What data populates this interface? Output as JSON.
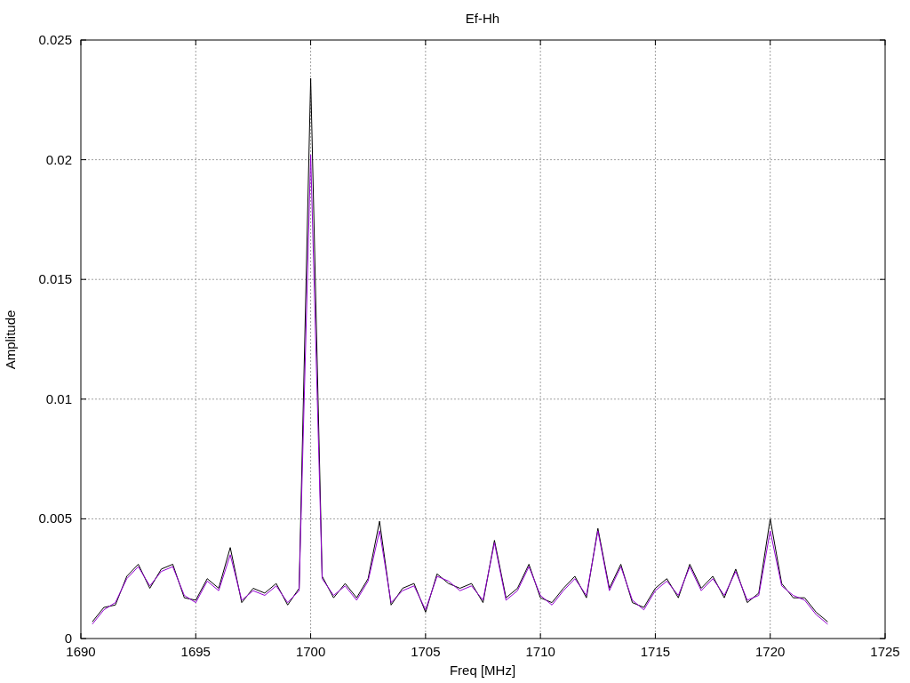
{
  "chart_data": {
    "type": "line",
    "grid": true,
    "title": "Ef-Hh",
    "xlabel": "Freq [MHz]",
    "ylabel": "Amplitude",
    "xlim": [
      1690,
      1725
    ],
    "ylim": [
      0,
      0.025
    ],
    "xticks": [
      1690,
      1695,
      1700,
      1705,
      1710,
      1715,
      1720,
      1725
    ],
    "yticks": [
      {
        "value": 0,
        "label": "0"
      },
      {
        "value": 0.005,
        "label": "0.005"
      },
      {
        "value": 0.01,
        "label": "0.01"
      },
      {
        "value": 0.015,
        "label": "0.015"
      },
      {
        "value": 0.02,
        "label": "0.02"
      },
      {
        "value": 0.025,
        "label": "0.025"
      }
    ],
    "x": [
      1690.5,
      1691,
      1691.5,
      1692,
      1692.5,
      1693,
      1693.5,
      1694,
      1694.5,
      1695,
      1695.5,
      1696,
      1696.5,
      1697,
      1697.5,
      1698,
      1698.5,
      1699,
      1699.5,
      1700,
      1700.5,
      1701,
      1701.5,
      1702,
      1702.5,
      1703,
      1703.5,
      1704,
      1704.5,
      1705,
      1705.5,
      1706,
      1706.5,
      1707,
      1707.5,
      1708,
      1708.5,
      1709,
      1709.5,
      1710,
      1710.5,
      1711,
      1711.5,
      1712,
      1712.5,
      1713,
      1713.5,
      1714,
      1714.5,
      1715,
      1715.5,
      1716,
      1716.5,
      1717,
      1717.5,
      1718,
      1718.5,
      1719,
      1719.5,
      1720,
      1720.5,
      1721,
      1721.5,
      1722,
      1722.5
    ],
    "series": [
      {
        "color": "#000000",
        "values": [
          0.0007,
          0.0013,
          0.0014,
          0.0026,
          0.0031,
          0.0021,
          0.0029,
          0.0031,
          0.0017,
          0.0016,
          0.0025,
          0.0021,
          0.0038,
          0.0015,
          0.0021,
          0.0019,
          0.0023,
          0.0014,
          0.0021,
          0.0234,
          0.0026,
          0.0017,
          0.0023,
          0.0017,
          0.0025,
          0.0049,
          0.0014,
          0.0021,
          0.0023,
          0.0011,
          0.0027,
          0.0023,
          0.0021,
          0.0023,
          0.0015,
          0.0041,
          0.0017,
          0.0021,
          0.0031,
          0.0017,
          0.0015,
          0.0021,
          0.0026,
          0.0017,
          0.0046,
          0.0021,
          0.0031,
          0.0015,
          0.0013,
          0.0021,
          0.0025,
          0.0017,
          0.0031,
          0.0021,
          0.0026,
          0.0017,
          0.0029,
          0.0015,
          0.0019,
          0.005,
          0.0023,
          0.0017,
          0.0017,
          0.0011,
          0.0007
        ]
      },
      {
        "color": "#9400d3",
        "values": [
          0.0006,
          0.0012,
          0.0015,
          0.0025,
          0.003,
          0.0022,
          0.0028,
          0.003,
          0.0018,
          0.0015,
          0.0024,
          0.002,
          0.0035,
          0.0016,
          0.002,
          0.0018,
          0.0022,
          0.0015,
          0.002,
          0.0202,
          0.0025,
          0.0018,
          0.0022,
          0.0016,
          0.0024,
          0.0045,
          0.0015,
          0.002,
          0.0022,
          0.0012,
          0.0026,
          0.0024,
          0.002,
          0.0022,
          0.0016,
          0.004,
          0.0016,
          0.002,
          0.003,
          0.0018,
          0.0014,
          0.002,
          0.0025,
          0.0018,
          0.0045,
          0.002,
          0.003,
          0.0016,
          0.0012,
          0.002,
          0.0024,
          0.0018,
          0.003,
          0.002,
          0.0025,
          0.0018,
          0.0028,
          0.0016,
          0.0018,
          0.0045,
          0.0022,
          0.0018,
          0.0016,
          0.001,
          0.0006
        ]
      }
    ]
  }
}
